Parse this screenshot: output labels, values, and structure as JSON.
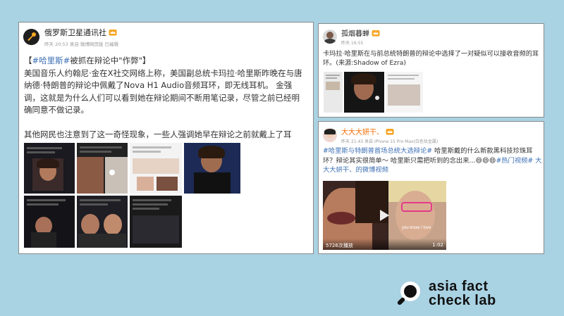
{
  "post_main": {
    "author": "俄罗斯卫星通讯社",
    "meta": "昨天 20:53 来自 微博网页版 已编辑",
    "title_open": "【",
    "title_tag": "#哈里斯#",
    "title_rest": "被抓在辩论中\"作弊\"】",
    "para1": "美国音乐人约翰尼·金在X社交网络上称，美国副总统卡玛拉·哈里斯昨晚在与唐纳德·特朗普的辩论中佩戴了Nova H1 Audio音频耳环，即无线耳机。 金强调，这就是为什么人们可以看到她在辩论期间不断用笔记录，尽管之前已经明确同意不做记录。",
    "para2": "其他网民也注意到了这一奇怪现象，一些人强调她早在辩论之前就戴上了耳环。"
  },
  "post_top": {
    "author": "孤烟暮蝉",
    "meta": "昨天 16:55",
    "text": "卡玛拉·哈里斯在与前总统特朗普的辩论中选择了一对疑似可以接收音频的耳环。(来源:Shadow of Ezra)"
  },
  "post_bottom": {
    "author": "大大大妍干、",
    "meta": "昨天 21:43 来自 iPhone 15 Pro Max(白色钛金属)",
    "tag1": "#哈里斯与特朗普首场总统大选辩论#",
    "text1": " 哈里斯戴的什么新款黑科技珍珠耳环？辩论其实很简单～ 哈里斯只需把听到的念出来...",
    "emojis": "😄😄😄",
    "tag2": "#热门视频#",
    "link_text": " 大大大妍干、的微博视频",
    "video_views": "5726次播放",
    "video_duration": "1:02",
    "video_caption": "you know I love"
  },
  "brand": {
    "line1": "asia fact",
    "line2": "check lab"
  },
  "colors": {
    "background": "#a9d2e3",
    "link": "#3c6fb4",
    "name_orange": "#f36b00"
  }
}
